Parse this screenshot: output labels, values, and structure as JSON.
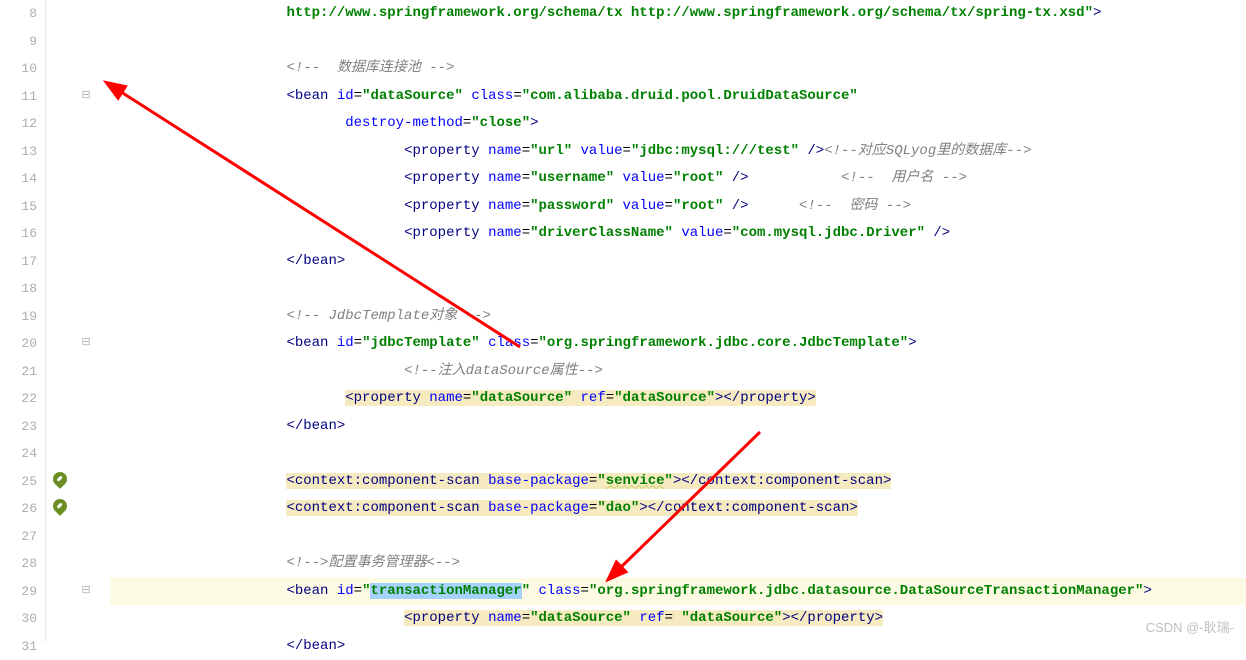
{
  "lines": [
    {
      "n": 8,
      "indent": 3,
      "segs": [
        {
          "t": "http://www.springframework.org/schema/tx http://www.springframework.org/schema/tx/spring-tx.xsd",
          "cls": "c-str"
        },
        {
          "t": "\"",
          "cls": "c-str"
        },
        {
          "t": ">",
          "cls": "c-nspunct"
        }
      ]
    },
    {
      "n": 9,
      "indent": 0,
      "segs": []
    },
    {
      "n": 10,
      "indent": 3,
      "segs": [
        {
          "t": "<!--  数据库连接池 -->",
          "cls": "c-comment"
        }
      ]
    },
    {
      "n": 11,
      "indent": 3,
      "fold": "-",
      "segs": [
        {
          "t": "<",
          "cls": "c-nspunct"
        },
        {
          "t": "bean ",
          "cls": "c-tag"
        },
        {
          "t": "id",
          "cls": "c-attr"
        },
        {
          "t": "=",
          "cls": "c-punct"
        },
        {
          "t": "\"dataSource\"",
          "cls": "c-str"
        },
        {
          "t": " ",
          "cls": ""
        },
        {
          "t": "class",
          "cls": "c-attr"
        },
        {
          "t": "=",
          "cls": "c-punct"
        },
        {
          "t": "\"com.alibaba.druid.pool.DruidDataSource\"",
          "cls": "c-str"
        }
      ]
    },
    {
      "n": 12,
      "indent": 4,
      "guide": true,
      "segs": [
        {
          "t": "destroy-method",
          "cls": "c-attr"
        },
        {
          "t": "=",
          "cls": "c-punct"
        },
        {
          "t": "\"close\"",
          "cls": "c-str"
        },
        {
          "t": ">",
          "cls": "c-nspunct"
        }
      ]
    },
    {
      "n": 13,
      "indent": 5,
      "guide": true,
      "segs": [
        {
          "t": "<",
          "cls": "c-nspunct"
        },
        {
          "t": "property ",
          "cls": "c-tag"
        },
        {
          "t": "name",
          "cls": "c-attr"
        },
        {
          "t": "=",
          "cls": "c-punct"
        },
        {
          "t": "\"url\"",
          "cls": "c-str"
        },
        {
          "t": " ",
          "cls": ""
        },
        {
          "t": "value",
          "cls": "c-attr"
        },
        {
          "t": "=",
          "cls": "c-punct"
        },
        {
          "t": "\"jdbc:mysql:///test\"",
          "cls": "c-str"
        },
        {
          "t": " />",
          "cls": "c-nspunct"
        },
        {
          "t": "<!--对应SQLyog里的数据库-->",
          "cls": "c-comment"
        }
      ]
    },
    {
      "n": 14,
      "indent": 5,
      "guide": true,
      "segs": [
        {
          "t": "<",
          "cls": "c-nspunct"
        },
        {
          "t": "property ",
          "cls": "c-tag"
        },
        {
          "t": "name",
          "cls": "c-attr"
        },
        {
          "t": "=",
          "cls": "c-punct"
        },
        {
          "t": "\"username\"",
          "cls": "c-str"
        },
        {
          "t": " ",
          "cls": ""
        },
        {
          "t": "value",
          "cls": "c-attr"
        },
        {
          "t": "=",
          "cls": "c-punct"
        },
        {
          "t": "\"root\"",
          "cls": "c-str"
        },
        {
          "t": " />",
          "cls": "c-nspunct"
        },
        {
          "t": "           ",
          "cls": ""
        },
        {
          "t": "<!--  用户名 -->",
          "cls": "c-comment"
        }
      ]
    },
    {
      "n": 15,
      "indent": 5,
      "guide": true,
      "segs": [
        {
          "t": "<",
          "cls": "c-nspunct"
        },
        {
          "t": "property ",
          "cls": "c-tag"
        },
        {
          "t": "name",
          "cls": "c-attr"
        },
        {
          "t": "=",
          "cls": "c-punct"
        },
        {
          "t": "\"password\"",
          "cls": "c-str"
        },
        {
          "t": " ",
          "cls": ""
        },
        {
          "t": "value",
          "cls": "c-attr"
        },
        {
          "t": "=",
          "cls": "c-punct"
        },
        {
          "t": "\"root\"",
          "cls": "c-str"
        },
        {
          "t": " />",
          "cls": "c-nspunct"
        },
        {
          "t": "      ",
          "cls": ""
        },
        {
          "t": "<!--  密码 -->",
          "cls": "c-comment"
        }
      ]
    },
    {
      "n": 16,
      "indent": 5,
      "guide": true,
      "segs": [
        {
          "t": "<",
          "cls": "c-nspunct"
        },
        {
          "t": "property ",
          "cls": "c-tag"
        },
        {
          "t": "name",
          "cls": "c-attr"
        },
        {
          "t": "=",
          "cls": "c-punct"
        },
        {
          "t": "\"driverClassName\"",
          "cls": "c-str"
        },
        {
          "t": " ",
          "cls": ""
        },
        {
          "t": "value",
          "cls": "c-attr"
        },
        {
          "t": "=",
          "cls": "c-punct"
        },
        {
          "t": "\"com.mysql.jdbc.Driver\"",
          "cls": "c-str"
        },
        {
          "t": " />",
          "cls": "c-nspunct"
        }
      ]
    },
    {
      "n": 17,
      "indent": 3,
      "segs": [
        {
          "t": "</",
          "cls": "c-nspunct"
        },
        {
          "t": "bean",
          "cls": "c-tag"
        },
        {
          "t": ">",
          "cls": "c-nspunct"
        }
      ]
    },
    {
      "n": 18,
      "indent": 0,
      "segs": []
    },
    {
      "n": 19,
      "indent": 3,
      "segs": [
        {
          "t": "<!-- JdbcTemplate对象 -->",
          "cls": "c-comment"
        }
      ]
    },
    {
      "n": 20,
      "indent": 3,
      "fold": "-",
      "segs": [
        {
          "t": "<",
          "cls": "c-nspunct"
        },
        {
          "t": "bean ",
          "cls": "c-tag"
        },
        {
          "t": "id",
          "cls": "c-attr"
        },
        {
          "t": "=",
          "cls": "c-punct"
        },
        {
          "t": "\"jdbcTemplate\"",
          "cls": "c-str"
        },
        {
          "t": " ",
          "cls": ""
        },
        {
          "t": "class",
          "cls": "c-attr"
        },
        {
          "t": "=",
          "cls": "c-punct"
        },
        {
          "t": "\"org.springframework.jdbc.core.JdbcTemplate\"",
          "cls": "c-str"
        },
        {
          "t": ">",
          "cls": "c-nspunct"
        }
      ]
    },
    {
      "n": 21,
      "indent": 5,
      "guide": true,
      "segs": [
        {
          "t": "<!--注入dataSource属性-->",
          "cls": "c-comment"
        }
      ]
    },
    {
      "n": 22,
      "indent": 4,
      "guide": true,
      "hl": true,
      "segs": [
        {
          "t": "<",
          "cls": "c-nspunct"
        },
        {
          "t": "property ",
          "cls": "c-tag"
        },
        {
          "t": "name",
          "cls": "c-attr"
        },
        {
          "t": "=",
          "cls": "c-punct"
        },
        {
          "t": "\"dataSource\"",
          "cls": "c-str"
        },
        {
          "t": " ",
          "cls": ""
        },
        {
          "t": "ref",
          "cls": "c-attr"
        },
        {
          "t": "=",
          "cls": "c-punct"
        },
        {
          "t": "\"dataSource\"",
          "cls": "c-str"
        },
        {
          "t": "></",
          "cls": "c-nspunct"
        },
        {
          "t": "property",
          "cls": "c-tag"
        },
        {
          "t": ">",
          "cls": "c-nspunct"
        }
      ]
    },
    {
      "n": 23,
      "indent": 3,
      "segs": [
        {
          "t": "</",
          "cls": "c-nspunct"
        },
        {
          "t": "bean",
          "cls": "c-tag"
        },
        {
          "t": ">",
          "cls": "c-nspunct"
        }
      ]
    },
    {
      "n": 24,
      "indent": 0,
      "segs": []
    },
    {
      "n": 25,
      "indent": 3,
      "icon": "bean",
      "hl": true,
      "segs": [
        {
          "t": "<",
          "cls": "c-nspunct"
        },
        {
          "t": "context:component-scan ",
          "cls": "c-tag"
        },
        {
          "t": "base-package",
          "cls": "c-attr"
        },
        {
          "t": "=",
          "cls": "c-punct"
        },
        {
          "t": "\"",
          "cls": "c-str"
        },
        {
          "t": "senvice",
          "cls": "c-str underline"
        },
        {
          "t": "\"",
          "cls": "c-str"
        },
        {
          "t": "></",
          "cls": "c-nspunct"
        },
        {
          "t": "context:component-scan",
          "cls": "c-tag"
        },
        {
          "t": ">",
          "cls": "c-nspunct"
        }
      ]
    },
    {
      "n": 26,
      "indent": 3,
      "icon": "bean",
      "hl": true,
      "segs": [
        {
          "t": "<",
          "cls": "c-nspunct"
        },
        {
          "t": "context:component-scan ",
          "cls": "c-tag"
        },
        {
          "t": "base-package",
          "cls": "c-attr"
        },
        {
          "t": "=",
          "cls": "c-punct"
        },
        {
          "t": "\"dao\"",
          "cls": "c-str"
        },
        {
          "t": "></",
          "cls": "c-nspunct"
        },
        {
          "t": "context:component-scan",
          "cls": "c-tag"
        },
        {
          "t": ">",
          "cls": "c-nspunct"
        }
      ]
    },
    {
      "n": 27,
      "indent": 0,
      "segs": []
    },
    {
      "n": 28,
      "indent": 3,
      "segs": [
        {
          "t": "<!-->配置事务管理器<-->",
          "cls": "c-comment"
        }
      ]
    },
    {
      "n": 29,
      "indent": 3,
      "fold": "-",
      "hlrow": true,
      "segs": [
        {
          "t": "<",
          "cls": "c-nspunct"
        },
        {
          "t": "bean ",
          "cls": "c-tag"
        },
        {
          "t": "id",
          "cls": "c-attr"
        },
        {
          "t": "=",
          "cls": "c-punct"
        },
        {
          "t": "\"",
          "cls": "c-str"
        },
        {
          "t": "transactionManager",
          "cls": "c-str",
          "sel": true
        },
        {
          "t": "\"",
          "cls": "c-str"
        },
        {
          "t": " ",
          "cls": ""
        },
        {
          "t": "class",
          "cls": "c-attr"
        },
        {
          "t": "=",
          "cls": "c-punct"
        },
        {
          "t": "\"org.springframework.jdbc.datasource.DataSourceTransactionManager\"",
          "cls": "c-str"
        },
        {
          "t": ">",
          "cls": "c-nspunct"
        }
      ]
    },
    {
      "n": 30,
      "indent": 5,
      "guide": true,
      "hl": true,
      "segs": [
        {
          "t": "<",
          "cls": "c-nspunct"
        },
        {
          "t": "property ",
          "cls": "c-tag"
        },
        {
          "t": "name",
          "cls": "c-attr"
        },
        {
          "t": "=",
          "cls": "c-punct"
        },
        {
          "t": "\"dataSource\"",
          "cls": "c-str"
        },
        {
          "t": " ",
          "cls": ""
        },
        {
          "t": "ref",
          "cls": "c-attr"
        },
        {
          "t": "=",
          "cls": "c-punct"
        },
        {
          "t": " ",
          "cls": ""
        },
        {
          "t": "\"dataSource\"",
          "cls": "c-str"
        },
        {
          "t": "></",
          "cls": "c-nspunct"
        },
        {
          "t": "property",
          "cls": "c-tag"
        },
        {
          "t": ">",
          "cls": "c-nspunct"
        }
      ]
    },
    {
      "n": 31,
      "indent": 3,
      "segs": [
        {
          "t": "</",
          "cls": "c-nspunct"
        },
        {
          "t": "bean",
          "cls": "c-tag"
        },
        {
          "t": ">",
          "cls": "c-nspunct"
        }
      ]
    }
  ],
  "watermark": "CSDN @-耿瑞-"
}
